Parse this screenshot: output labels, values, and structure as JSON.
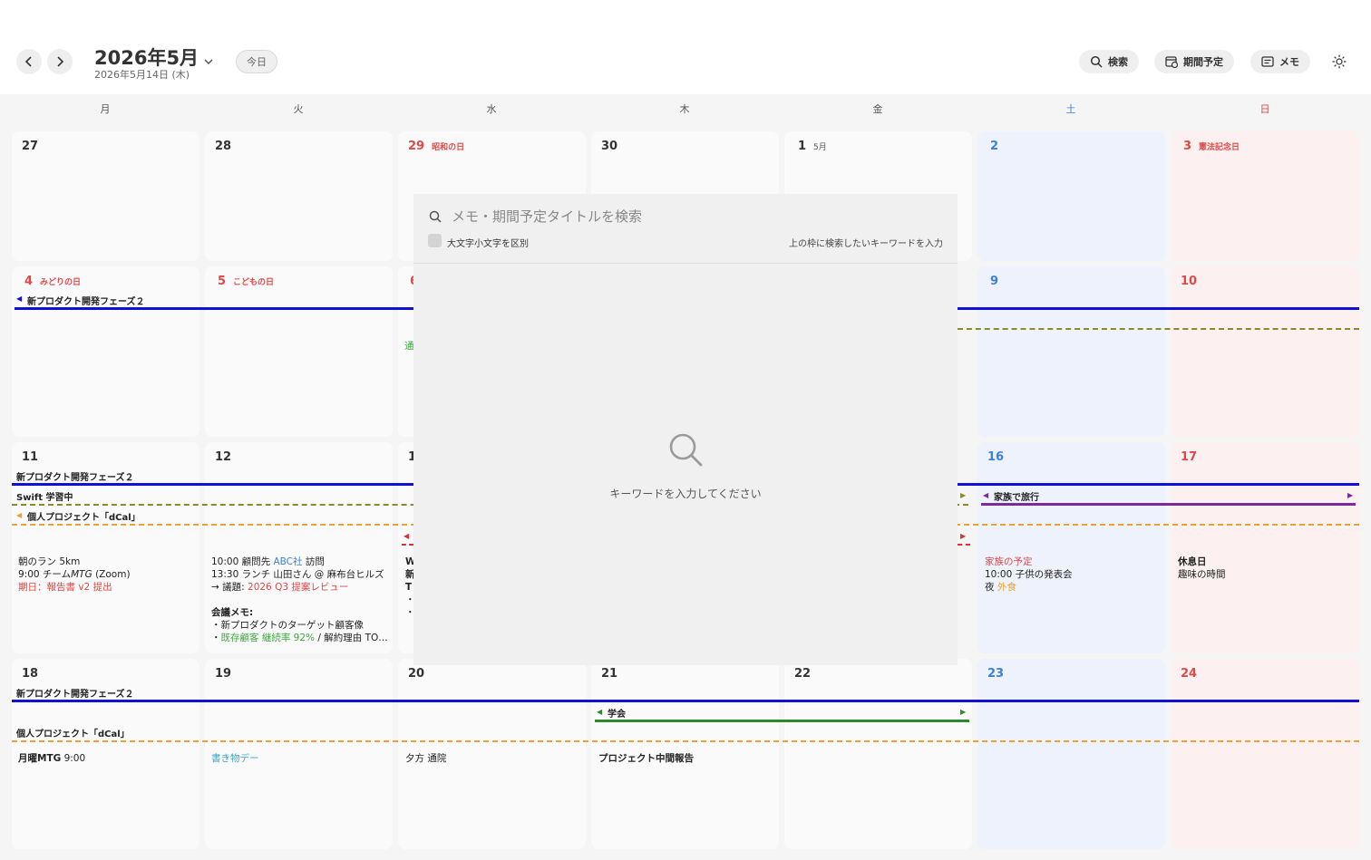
{
  "header": {
    "month_title": "2026年5月",
    "date_sub": "2026年5月14日 (木)",
    "today_label": "今日",
    "buttons": {
      "search": "検索",
      "period": "期間予定",
      "memo": "メモ"
    }
  },
  "weekdays": [
    "月",
    "火",
    "水",
    "木",
    "金",
    "土",
    "日"
  ],
  "days": {
    "w1": [
      "27",
      "28",
      "29",
      "30",
      "1",
      "2",
      "3"
    ],
    "w2": [
      "4",
      "5",
      "6",
      "",
      "",
      "9",
      "10"
    ],
    "w3": [
      "11",
      "12",
      "1",
      "",
      "",
      "16",
      "17"
    ],
    "w4": [
      "18",
      "19",
      "20",
      "21",
      "22",
      "23",
      "24"
    ]
  },
  "holidays": {
    "showa": "昭和の日",
    "month_marker": "5月",
    "kenpo": "憲法記念日",
    "midori": "みどりの日",
    "kodomo": "こどもの日"
  },
  "events": {
    "phase2": "新プロダクト開発フェーズ２",
    "swift": "Swift 学習中",
    "dcal": "個人プロジェクト「dCal」",
    "family_trip": "家族で旅行",
    "conference": "学会"
  },
  "notes": {
    "w2_wed_fragment": "通",
    "mon11": [
      "朝のラン 5km",
      "9:00 チーム",
      "MTG",
      " (Zoom)",
      "期日：報告書 v2 提出"
    ],
    "tue12": {
      "l1a": "10:00 顧問先 ",
      "l1b": "ABC社",
      "l1c": " 訪問",
      "l2": "13:30 ランチ 山田さん @ 麻布台ヒルズ",
      "l3a": "→ 議題: ",
      "l3b": "2026 Q3 提案レビュー",
      "l4": "会議メモ:",
      "l5": "・新プロダクトのターゲット顧客像",
      "l6a": "・",
      "l6b": "既存顧客 継続率 92%",
      "l6c": " / 解約理由 TO…"
    },
    "wed13": [
      "W",
      "新",
      "T",
      "・",
      "・"
    ],
    "sat16": [
      "家族の予定",
      "10:00 子供の発表会",
      "夜 ",
      "外食"
    ],
    "sun17": [
      "休息日",
      "趣味の時間"
    ],
    "mon18": [
      "月曜MTG",
      " 9:00"
    ],
    "tue19": "書き物デー",
    "wed20": "夕方 通院",
    "thu21": "プロジェクト中間報告"
  },
  "search_panel": {
    "placeholder": "メモ・期間予定タイトルを検索",
    "case_label": "大文字小文字を区別",
    "hint": "上の枠に検索したいキーワードを入力",
    "empty": "キーワードを入力してください"
  },
  "colors": {
    "accent_blue": "#1010d8",
    "saturday": "#3d7fd9",
    "sunday": "#e04848",
    "trip": "#7a2a9a",
    "conference": "#2a8a2a",
    "dcal": "#f0a030"
  }
}
